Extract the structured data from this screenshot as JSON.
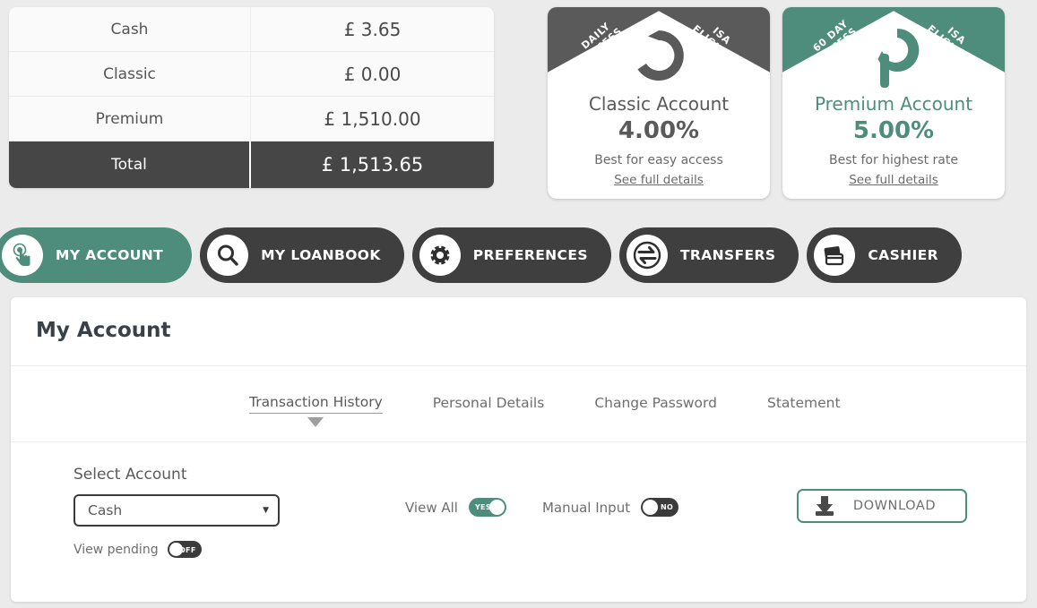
{
  "balances": {
    "rows": [
      {
        "label": "Cash",
        "value": "£ 3.65"
      },
      {
        "label": "Classic",
        "value": "£ 0.00"
      },
      {
        "label": "Premium",
        "value": "£ 1,510.00"
      }
    ],
    "total": {
      "label": "Total",
      "value": "£ 1,513.65"
    }
  },
  "cards": [
    {
      "id": "classic",
      "ribbon_left": "DAILY<br>ACCESS",
      "ribbon_right": "ISA<br>ELIGIBLE",
      "logo": "classic-c-logo",
      "name": "Classic Account",
      "rate": "4.00%",
      "subtitle": "Best for easy access",
      "link": "See full details",
      "color": "#5a5a5a"
    },
    {
      "id": "premium",
      "ribbon_left": "60 DAY<br>ACCESS",
      "ribbon_right": "ISA<br>ELIGIBLE",
      "logo": "premium-p-logo",
      "name": "Premium Account",
      "rate": "5.00%",
      "subtitle": "Best for highest rate",
      "link": "See full details",
      "color": "#4e8d7c"
    }
  ],
  "nav": [
    {
      "label": "MY ACCOUNT",
      "icon": "hand-tap-icon",
      "active": true
    },
    {
      "label": "MY LOANBOOK",
      "icon": "magnifier-icon",
      "active": false
    },
    {
      "label": "PREFERENCES",
      "icon": "gear-icon",
      "active": false
    },
    {
      "label": "TRANSFERS",
      "icon": "transfer-arrows-icon",
      "active": false
    },
    {
      "label": "CASHIER",
      "icon": "credit-cards-icon",
      "active": false
    }
  ],
  "panel": {
    "title": "My Account",
    "subtabs": [
      {
        "label": "Transaction History",
        "active": true
      },
      {
        "label": "Personal Details",
        "active": false
      },
      {
        "label": "Change Password",
        "active": false
      },
      {
        "label": "Statement",
        "active": false
      }
    ],
    "select_account_label": "Select Account",
    "select_account_value": "Cash",
    "select_caret": "▼",
    "view_pending_label": "View pending",
    "view_pending_state": "OFF",
    "view_all_label": "View All",
    "view_all_state": "YES",
    "manual_input_label": "Manual Input",
    "manual_input_state": "NO",
    "download_label": "DOWNLOAD"
  },
  "theme": {
    "accent": "#4e8d7c",
    "dark": "#3f3f3f",
    "page_bg": "#ebebeb"
  }
}
